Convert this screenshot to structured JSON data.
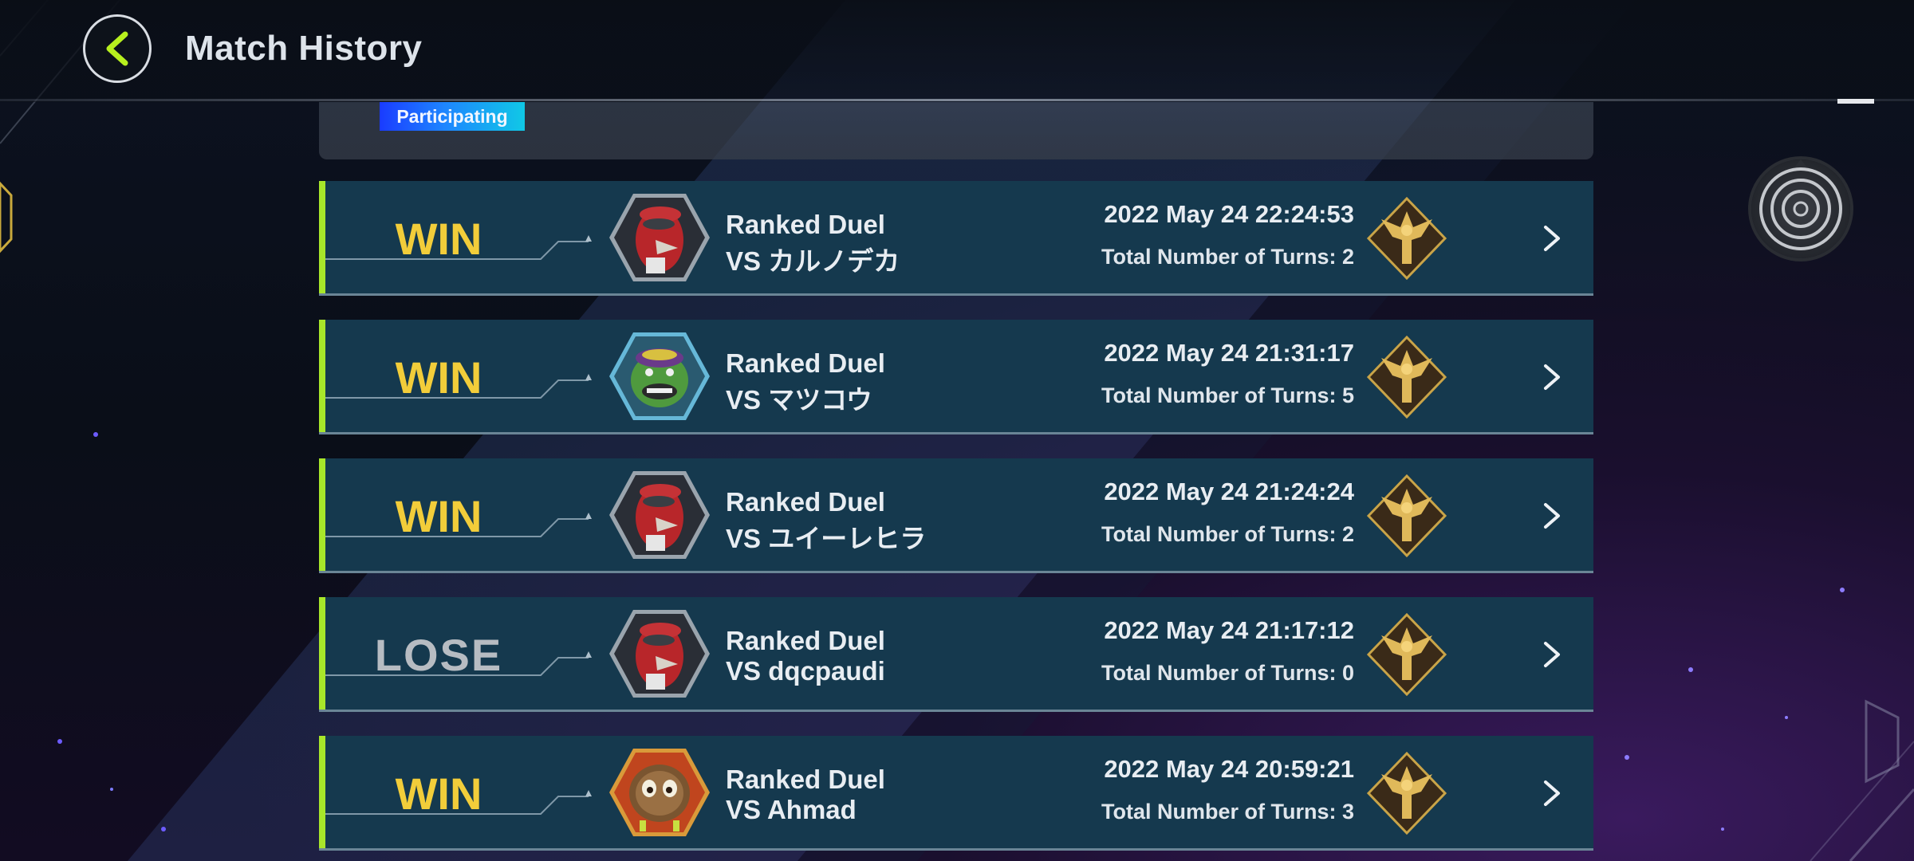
{
  "header": {
    "title": "Match History"
  },
  "filter": {
    "badge": "Participating"
  },
  "colors": {
    "win": "#f2cd3a",
    "lose": "#b7bcc2",
    "row_bg": "#15394e",
    "accent": "#a8e62a",
    "header_back_arrow": "#b7f01e"
  },
  "matches": [
    {
      "result": "WIN",
      "mode": "Ranked Duel",
      "opponent": "VS カルノデカ",
      "date": "2022 May 24 22:24:53",
      "turns": "Total Number of Turns: 2",
      "avatar_icon": "red-bird-avatar-icon",
      "rank_icon": "gold-rank-icon"
    },
    {
      "result": "WIN",
      "mode": "Ranked Duel",
      "opponent": "VS マツコウ",
      "date": "2022 May 24 21:31:17",
      "turns": "Total Number of Turns: 5",
      "avatar_icon": "green-goblin-avatar-icon",
      "rank_icon": "gold-rank-icon"
    },
    {
      "result": "WIN",
      "mode": "Ranked Duel",
      "opponent": "VS ユイーレヒラ",
      "date": "2022 May 24 21:24:24",
      "turns": "Total Number of Turns: 2",
      "avatar_icon": "red-bird-avatar-icon",
      "rank_icon": "gold-rank-icon"
    },
    {
      "result": "LOSE",
      "mode": "Ranked Duel",
      "opponent": "VS dqcpaudi",
      "date": "2022 May 24 21:17:12",
      "turns": "Total Number of Turns: 0",
      "avatar_icon": "red-bird-avatar-icon",
      "rank_icon": "gold-rank-icon"
    },
    {
      "result": "WIN",
      "mode": "Ranked Duel",
      "opponent": "VS Ahmad",
      "date": "2022 May 24 20:59:21",
      "turns": "Total Number of Turns: 3",
      "avatar_icon": "kuriboh-avatar-icon",
      "rank_icon": "gold-rank-icon"
    }
  ]
}
